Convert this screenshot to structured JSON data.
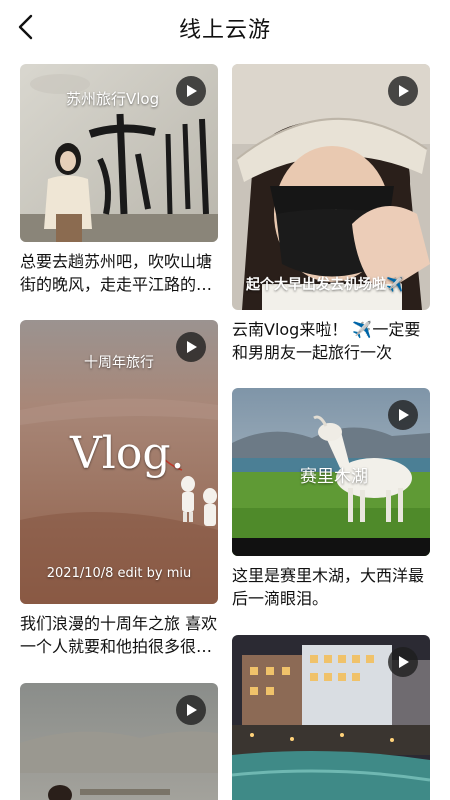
{
  "header": {
    "title": "线上云游",
    "back_icon": "chevron-left-icon"
  },
  "cards": [
    {
      "overlay_title": "苏州旅行Vlog",
      "overlay_big": "苏州",
      "caption": "总要去趟苏州吧，吹吹山塘街的晚风，走走平江路的小巷"
    },
    {
      "overlay_text": "起个大早出发去机场啦✈️",
      "caption": "云南Vlog来啦！ ✈️一定要和男朋友一起旅行一次"
    },
    {
      "overlay_top": "十周年旅行",
      "overlay_vlog": "Vlog.",
      "overlay_bottom": "2021/10/8 edit by miu",
      "caption": "我们浪漫的十周年之旅 喜欢一个人就要和他拍很多很多照片"
    },
    {
      "overlay_text": "赛里木湖",
      "caption": "这里是赛里木湖，大西洋最后一滴眼泪。"
    },
    {
      "caption": ""
    },
    {
      "caption": ""
    }
  ],
  "icons": {
    "play": "play-icon"
  },
  "colors": {
    "play_bg": "#1e1e1e",
    "text": "#111111",
    "background": "#ffffff"
  }
}
